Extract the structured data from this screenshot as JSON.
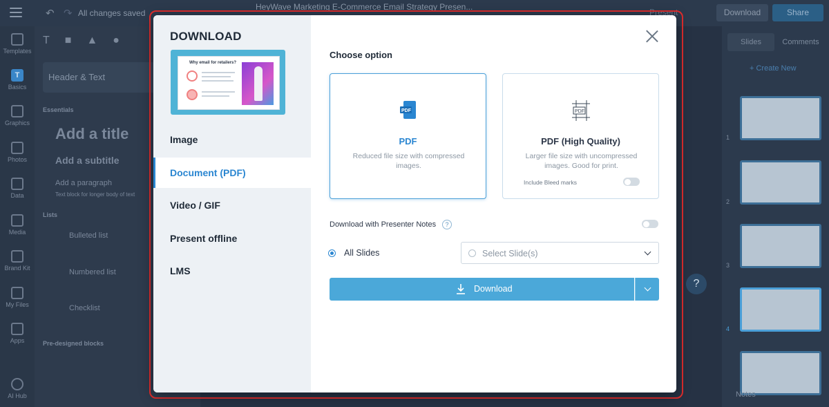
{
  "topbar": {
    "status": "All changes saved",
    "title": "HeyWave Marketing E-Commerce Email Strategy Presen...",
    "present_label": "Present",
    "download_label": "Download",
    "share_label": "Share"
  },
  "leftrail": {
    "items": [
      "Templates",
      "Basics",
      "Graphics",
      "Photos",
      "Data",
      "Media",
      "Brand Kit",
      "My Files",
      "Apps",
      "AI Hub"
    ]
  },
  "leftpanel": {
    "header": "Header & Text",
    "essentials": "Essentials",
    "title": "Add a title",
    "subtitle": "Add a subtitle",
    "paragraph": "Add a paragraph",
    "paragraph_hint": "Text block for longer body of text",
    "lists": "Lists",
    "bulleted": "Bulleted list",
    "numbered": "Numbered list",
    "checklist": "Checklist",
    "predesigned": "Pre-designed blocks"
  },
  "rightpanel": {
    "tab_slides": "Slides",
    "tab_comments": "Comments",
    "create_new": "+ Create New",
    "slide_numbers": [
      "1",
      "2",
      "3",
      "4"
    ],
    "notes": "Notes"
  },
  "modal": {
    "heading": "DOWNLOAD",
    "preview_title": "Why email for retailers?",
    "nav": [
      "Image",
      "Document (PDF)",
      "Video / GIF",
      "Present offline",
      "LMS"
    ],
    "active_nav": "Document (PDF)",
    "choose_label": "Choose option",
    "options": [
      {
        "title": "PDF",
        "desc": "Reduced file size with compressed images.",
        "selected": true,
        "icon": "pdf-icon"
      },
      {
        "title": "PDF (High Quality)",
        "desc": "Larger file size with uncompressed images. Good for print.",
        "selected": false,
        "icon": "pdf-hq-icon"
      }
    ],
    "bleed_label": "Include Bleed marks",
    "presenter_notes_label": "Download with Presenter Notes",
    "help_glyph": "?",
    "all_slides_label": "All Slides",
    "select_slides_placeholder": "Select Slide(s)",
    "download_button": "Download"
  },
  "colors": {
    "accent": "#2a86d1",
    "button": "#4ba8d9",
    "highlight_border": "#e02d2d"
  }
}
